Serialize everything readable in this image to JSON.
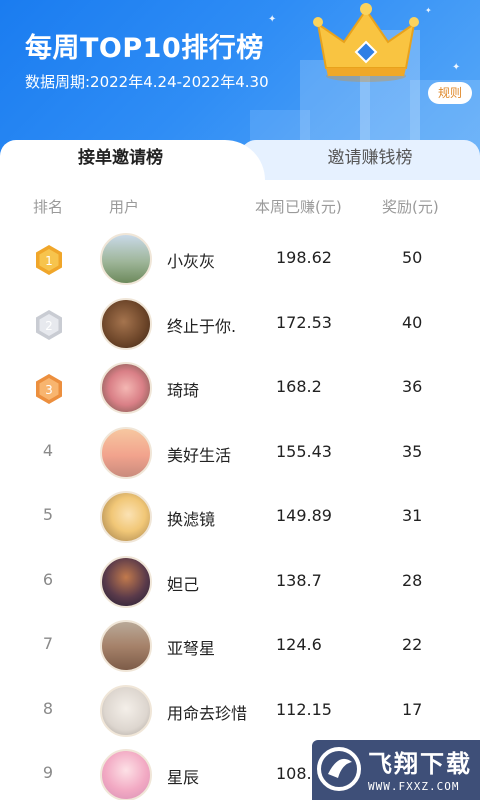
{
  "header": {
    "title": "每周TOP10排行榜",
    "period": "数据周期:2022年4.24-2022年4.30",
    "rules_label": "规则"
  },
  "tabs": [
    {
      "label": "接单邀请榜",
      "active": true
    },
    {
      "label": "邀请赚钱榜",
      "active": false
    }
  ],
  "columns": {
    "rank": "排名",
    "user": "用户",
    "earned": "本周已赚(元)",
    "reward": "奖励(元)"
  },
  "rows": [
    {
      "rank": "1",
      "name": "小灰灰",
      "earned": "198.62",
      "reward": "50",
      "medal": "gold",
      "avatar": "landscape-photo"
    },
    {
      "rank": "2",
      "name": "终止于你.",
      "earned": "172.53",
      "reward": "40",
      "medal": "silver",
      "avatar": "bear-photo"
    },
    {
      "rank": "3",
      "name": "琦琦",
      "earned": "168.2",
      "reward": "36",
      "medal": "bronze",
      "avatar": "roses-photo"
    },
    {
      "rank": "4",
      "name": "美好生活",
      "earned": "155.43",
      "reward": "35",
      "medal": null,
      "avatar": "sunset-photo"
    },
    {
      "rank": "5",
      "name": "换滤镜",
      "earned": "149.89",
      "reward": "31",
      "medal": null,
      "avatar": "cartoon-girl-photo"
    },
    {
      "rank": "6",
      "name": "妲己",
      "earned": "138.7",
      "reward": "28",
      "medal": null,
      "avatar": "game-character-photo"
    },
    {
      "rank": "7",
      "name": "亚弩星",
      "earned": "124.6",
      "reward": "22",
      "medal": null,
      "avatar": "desert-photo"
    },
    {
      "rank": "8",
      "name": "用命去珍惜",
      "earned": "112.15",
      "reward": "17",
      "medal": null,
      "avatar": "person-camera-photo"
    },
    {
      "rank": "9",
      "name": "星辰",
      "earned": "108.",
      "reward": "",
      "medal": null,
      "avatar": "woman-portrait-photo"
    }
  ],
  "watermark": {
    "brand": "飞翔下载",
    "url": "WWW.FXXZ.COM"
  },
  "colors": {
    "header_blue": "#1a7cf0",
    "tab_inactive_bg": "#e6f1ff",
    "gold": "#f5b83a",
    "silver": "#d8dbe0",
    "bronze": "#f3a35c",
    "rules_text": "#e0892a"
  }
}
